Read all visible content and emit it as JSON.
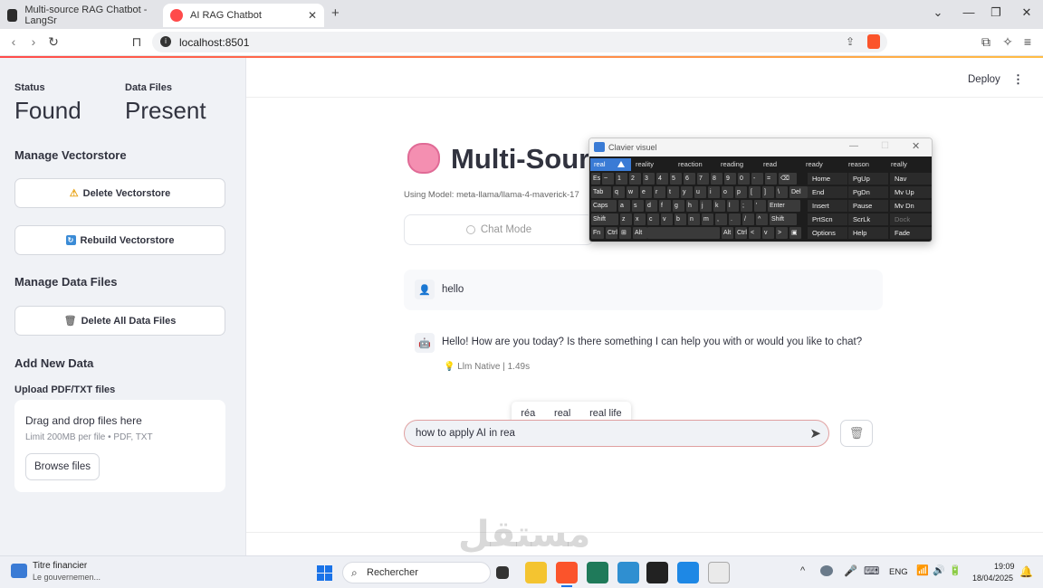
{
  "browser": {
    "tab1_title": "Multi-source RAG Chatbot - LangSr",
    "tab2_title": "AI RAG Chatbot",
    "new_tab": "+",
    "url": "localhost:8501"
  },
  "sidebar": {
    "status_label": "Status",
    "status_value": "Found",
    "files_label": "Data Files",
    "files_value": "Present",
    "manage_vs": "Manage Vectorstore",
    "delete_vs": "Delete Vectorstore",
    "rebuild_vs": "Rebuild Vectorstore",
    "manage_df": "Manage Data Files",
    "delete_df": "Delete All Data Files",
    "add_new": "Add New Data",
    "upload_label": "Upload PDF/TXT files",
    "drop_text": "Drag and drop files here",
    "drop_limit": "Limit 200MB per file • PDF, TXT",
    "browse": "Browse files"
  },
  "main": {
    "deploy": "Deploy",
    "title": "Multi-Sour",
    "model_caption": "Using Model: meta-llama/llama-4-maverick-17",
    "chat_mode": "Chat Mode",
    "user_msg": "hello",
    "bot_msg": "Hello! How are you today? Is there something I can help you with or would you like to chat?",
    "bot_meta": "Llm Native | 1.49s",
    "input_value": "how to apply AI in rea",
    "suggestions": [
      "réa",
      "real",
      "real life"
    ]
  },
  "keyboard": {
    "title": "Clavier visuel",
    "suggestions": [
      "real",
      "reality",
      "reaction",
      "reading",
      "read",
      "ready",
      "reason",
      "really"
    ],
    "row1": [
      "Esc",
      "~",
      "1",
      "2",
      "3",
      "4",
      "5",
      "6",
      "7",
      "8",
      "9",
      "0",
      "-",
      "=",
      "⌫"
    ],
    "row2": [
      "Tab",
      "q",
      "w",
      "e",
      "r",
      "t",
      "y",
      "u",
      "i",
      "o",
      "p",
      "[",
      "]",
      "\\",
      "Del"
    ],
    "row3": [
      "Caps",
      "a",
      "s",
      "d",
      "f",
      "g",
      "h",
      "j",
      "k",
      "l",
      ";",
      "'",
      "Enter"
    ],
    "row4": [
      "Shift",
      "z",
      "x",
      "c",
      "v",
      "b",
      "n",
      "m",
      ",",
      ".",
      "/",
      "^",
      "Shift"
    ],
    "row5": [
      "Fn",
      "Ctrl",
      "⊞",
      "Alt",
      "Alt",
      "Ctrl",
      "<",
      "v",
      ">",
      "▣"
    ],
    "side": [
      [
        "Home",
        "PgUp",
        "Nav"
      ],
      [
        "End",
        "PgDn",
        "Mv Up"
      ],
      [
        "Insert",
        "Pause",
        "Mv Dn"
      ],
      [
        "PrtScn",
        "ScrLk",
        "Dock"
      ],
      [
        "Options",
        "Help",
        "Fade"
      ]
    ]
  },
  "taskbar": {
    "widget_title": "Titre financier",
    "widget_sub": "Le gouvernemen...",
    "search": "Rechercher",
    "lang": "ENG",
    "time": "19:09",
    "date": "18/04/2025"
  },
  "watermark": "مستقل"
}
